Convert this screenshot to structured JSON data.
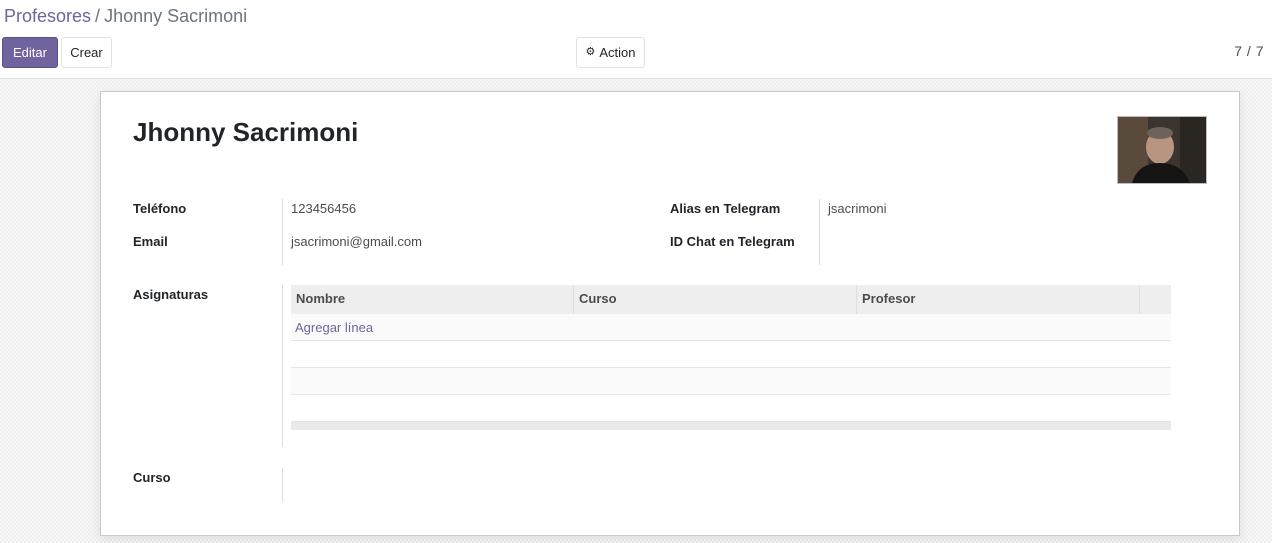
{
  "breadcrumb": {
    "parent": "Profesores",
    "separator": "/",
    "current": "Jhonny Sacrimoni"
  },
  "toolbar": {
    "edit_label": "Editar",
    "create_label": "Crear",
    "action_label": "Action",
    "action_icon": "gear-icon"
  },
  "pager": {
    "value": "7 / 7"
  },
  "record": {
    "name": "Jhonny Sacrimoni",
    "fields": {
      "telefono": {
        "label": "Teléfono",
        "value": "123456456"
      },
      "email": {
        "label": "Email",
        "value": "jsacrimoni@gmail.com"
      },
      "alias_telegram": {
        "label": "Alias en Telegram",
        "value": "jsacrimoni"
      },
      "id_chat_telegram": {
        "label": "ID Chat en Telegram",
        "value": ""
      },
      "asignaturas": {
        "label": "Asignaturas"
      },
      "curso": {
        "label": "Curso",
        "value": ""
      }
    }
  },
  "asignaturas_table": {
    "columns": [
      "Nombre",
      "Curso",
      "Profesor"
    ],
    "add_line_label": "Agregar línea",
    "rows": []
  },
  "colors": {
    "accent": "#71639e",
    "accent_border": "#5e5086",
    "header_bg": "#eeeeee"
  }
}
